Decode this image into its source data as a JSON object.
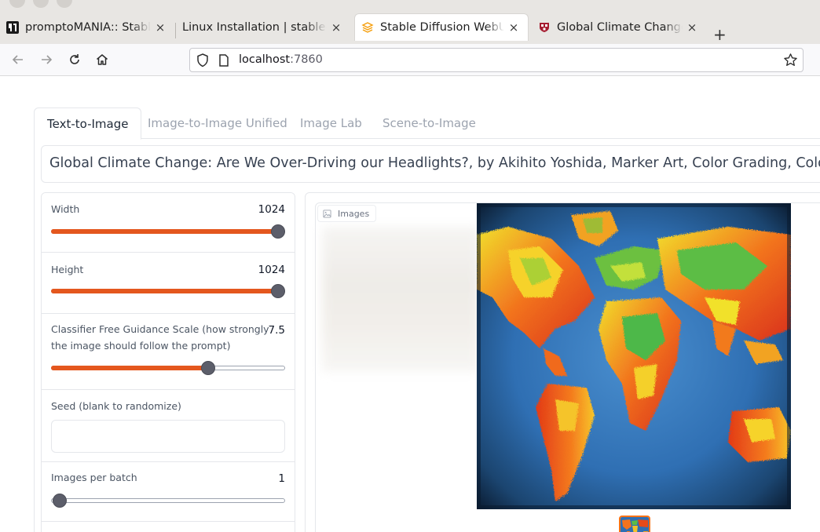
{
  "browser": {
    "tabs": [
      {
        "label": "promptoMANIA:: Stable Diffusion",
        "close": "×"
      },
      {
        "label": "Linux Installation | stable-diffusion",
        "close": "×"
      },
      {
        "label": "Stable Diffusion WebUI",
        "close": "×"
      },
      {
        "label": "Global Climate Change: Are We",
        "close": "×"
      }
    ],
    "new_tab": "+",
    "url_host": "localhost",
    "url_port": ":7860"
  },
  "app": {
    "tabs": [
      {
        "label": "Text-to-Image"
      },
      {
        "label": "Image-to-Image Unified"
      },
      {
        "label": "Image Lab"
      },
      {
        "label": "Scene-to-Image"
      }
    ],
    "prompt": "Global Climate Change: Are We Over-Driving our Headlights?, by Akihito Yoshida, Marker Art, Color Grading, Colorful, HD, Exc",
    "controls": {
      "width": {
        "label": "Width",
        "value": "1024",
        "fraction": 1.0
      },
      "height": {
        "label": "Height",
        "value": "1024",
        "fraction": 1.0
      },
      "cfg": {
        "label": "Classifier Free Guidance Scale (how strongly the image should follow the prompt)",
        "value": "7.5",
        "fraction": 0.64
      },
      "seed": {
        "label": "Seed (blank to randomize)",
        "value": ""
      },
      "batch": {
        "label": "Images per batch",
        "value": "1",
        "fraction": 0.0
      }
    },
    "gallery": {
      "label": "Images"
    }
  },
  "colors": {
    "accent": "#e4571e",
    "thumb": "#5c5e6a",
    "border": "#e5e7eb"
  }
}
